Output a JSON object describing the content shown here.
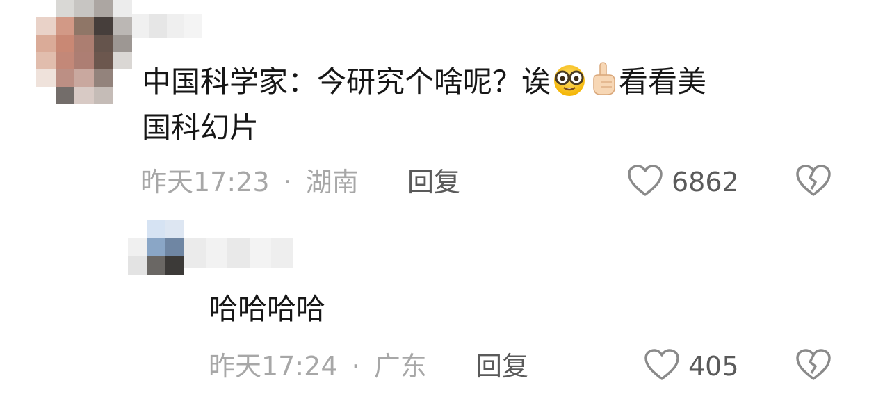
{
  "comments": [
    {
      "text_before_emoji": "中国科学家：今研究个啥呢？诶",
      "text_after_emoji": "看看美",
      "text_line2": "国科幻片",
      "emojis": [
        "nerd-face-emoji",
        "pointing-up-emoji"
      ],
      "time": "昨天17:23",
      "separator": "·",
      "location": "湖南",
      "reply_label": "回复",
      "likes": "6862"
    },
    {
      "text": "哈哈哈哈",
      "time": "昨天17:24",
      "separator": "·",
      "location": "广东",
      "reply_label": "回复",
      "likes": "405"
    }
  ],
  "colors": {
    "text": "#161616",
    "meta": "#a7a7a7",
    "action": "#5a5a5a",
    "icon": "#8a8a8a"
  }
}
